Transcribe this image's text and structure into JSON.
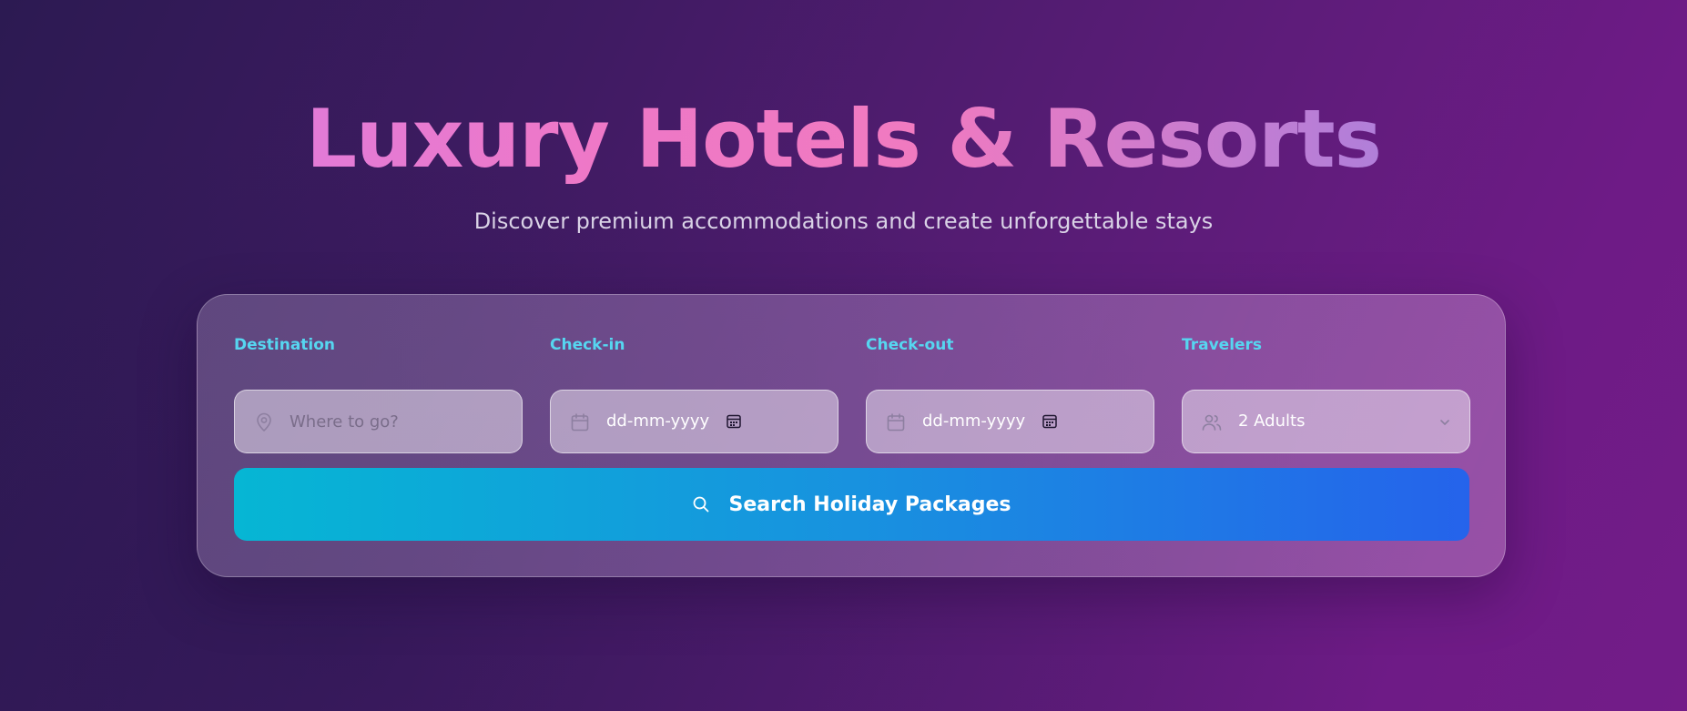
{
  "hero": {
    "title": "Luxury Hotels & Resorts",
    "subtitle": "Discover premium accommodations and create unforgettable stays"
  },
  "search_form": {
    "destination": {
      "label": "Destination",
      "placeholder": "Where to go?",
      "icon": "map-pin-icon"
    },
    "check_in": {
      "label": "Check-in",
      "value": "dd-mm-yyyy",
      "icon": "calendar-icon"
    },
    "check_out": {
      "label": "Check-out",
      "value": "dd-mm-yyyy",
      "icon": "calendar-icon"
    },
    "travelers": {
      "label": "Travelers",
      "selected": "2 Adults",
      "icon": "users-icon"
    },
    "submit_label": "Search Holiday Packages",
    "submit_icon": "search-icon"
  },
  "colors": {
    "label_accent": "#56d6f0",
    "button_gradient_start": "#06b6d4",
    "button_gradient_end": "#2563eb",
    "title_gradient_start": "#d67de8",
    "title_gradient_mid": "#f07ac0",
    "title_gradient_end": "#8e8ee6"
  }
}
